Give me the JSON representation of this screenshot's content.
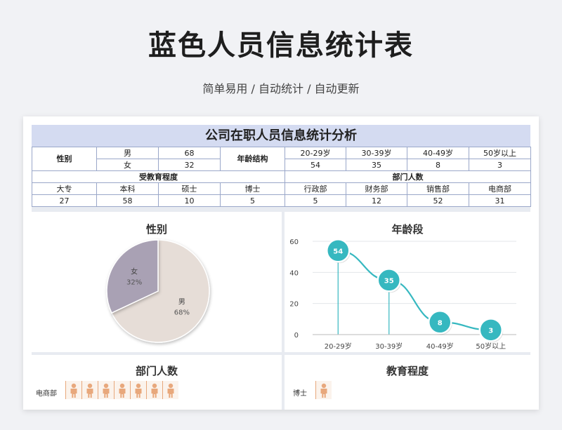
{
  "header": {
    "title": "蓝色人员信息统计表",
    "subtitle": "简单易用 / 自动统计 / 自动更新"
  },
  "sheet": {
    "title": "公司在职人员信息统计分析",
    "gender": {
      "label": "性别",
      "rows": [
        {
          "name": "男",
          "count": "68"
        },
        {
          "name": "女",
          "count": "32"
        }
      ]
    },
    "age": {
      "label": "年龄结构",
      "groups": [
        "20-29岁",
        "30-39岁",
        "40-49岁",
        "50岁以上"
      ],
      "counts": [
        "54",
        "35",
        "8",
        "3"
      ]
    },
    "education": {
      "label": "受教育程度",
      "groups": [
        "大专",
        "本科",
        "硕士",
        "博士"
      ],
      "counts": [
        "27",
        "58",
        "10",
        "5"
      ]
    },
    "department": {
      "label": "部门人数",
      "groups": [
        "行政部",
        "财务部",
        "销售部",
        "电商部"
      ],
      "counts": [
        "5",
        "12",
        "52",
        "31"
      ]
    }
  },
  "panels": {
    "gender_title": "性别",
    "age_title": "年龄段",
    "dept_title": "部门人数",
    "edu_title": "教育程度",
    "dept_first_label": "电商部",
    "edu_first_label": "博士"
  },
  "chart_data": [
    {
      "type": "pie",
      "title": "性别",
      "labels": [
        "男",
        "女"
      ],
      "values": [
        68,
        32
      ],
      "percent_labels": [
        "68%",
        "32%"
      ],
      "colors": [
        "#e6ddd7",
        "#a9a1b4"
      ]
    },
    {
      "type": "line",
      "title": "年龄段",
      "categories": [
        "20-29岁",
        "30-39岁",
        "40-49岁",
        "50岁以上"
      ],
      "values": [
        54,
        35,
        8,
        3
      ],
      "ylim": [
        0,
        60
      ],
      "yticks": [
        0,
        20,
        40,
        60
      ],
      "grid": true,
      "color": "#36b8c0"
    }
  ],
  "icon_rows": {
    "dept_icon_count": 7,
    "edu_icon_count": 1,
    "icon": "person-icon",
    "icon_color": "#e8a87c"
  }
}
